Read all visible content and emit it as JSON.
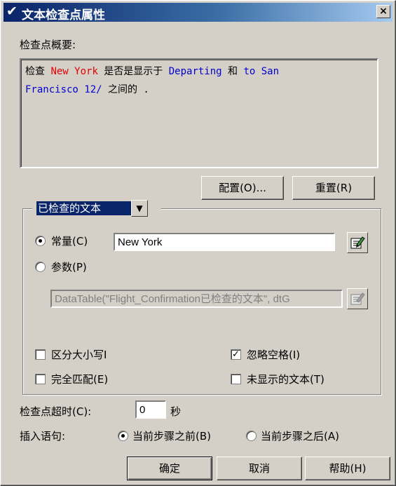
{
  "window": {
    "title": "文本检查点属性",
    "close_label": "×"
  },
  "summary": {
    "label": "检查点概要:",
    "parts": {
      "p1": "检查 ",
      "p2": "New York",
      "p3": " 是否是显示于 ",
      "p4": "Departing",
      "p5": " 和 ",
      "p6": "to San",
      "p7": "Francisco 12/",
      "p8": " 之间的 ."
    }
  },
  "buttons": {
    "configure": "配置(O)...",
    "reset": "重置(R)",
    "ok": "确定",
    "cancel": "取消",
    "help": "帮助(H)"
  },
  "checked_text": {
    "combo_value": "已检查的文本",
    "constant_label": "常量(C)",
    "constant_selected": true,
    "constant_value": "New York",
    "parameter_label": "参数(P)",
    "parameter_value": "DataTable(\"Flight_Confirmation已检查的文本\", dtG"
  },
  "options": {
    "match_case": {
      "label": "区分大小写I",
      "checked": false
    },
    "exact_match": {
      "label": "完全匹配(E)",
      "checked": false
    },
    "ignore_spaces": {
      "label": "忽略空格(I)",
      "checked": true
    },
    "text_not_displayed": {
      "label": "未显示的文本(T)",
      "checked": false
    }
  },
  "timeout": {
    "label": "检查点超时(C):",
    "value": "0",
    "unit": "秒"
  },
  "insert": {
    "label": "插入语句:",
    "before": "当前步骤之前(B)",
    "after": "当前步骤之后(A)",
    "selected": "before"
  },
  "icons": {
    "edit": "edit-icon",
    "check": "checkmark-icon"
  }
}
